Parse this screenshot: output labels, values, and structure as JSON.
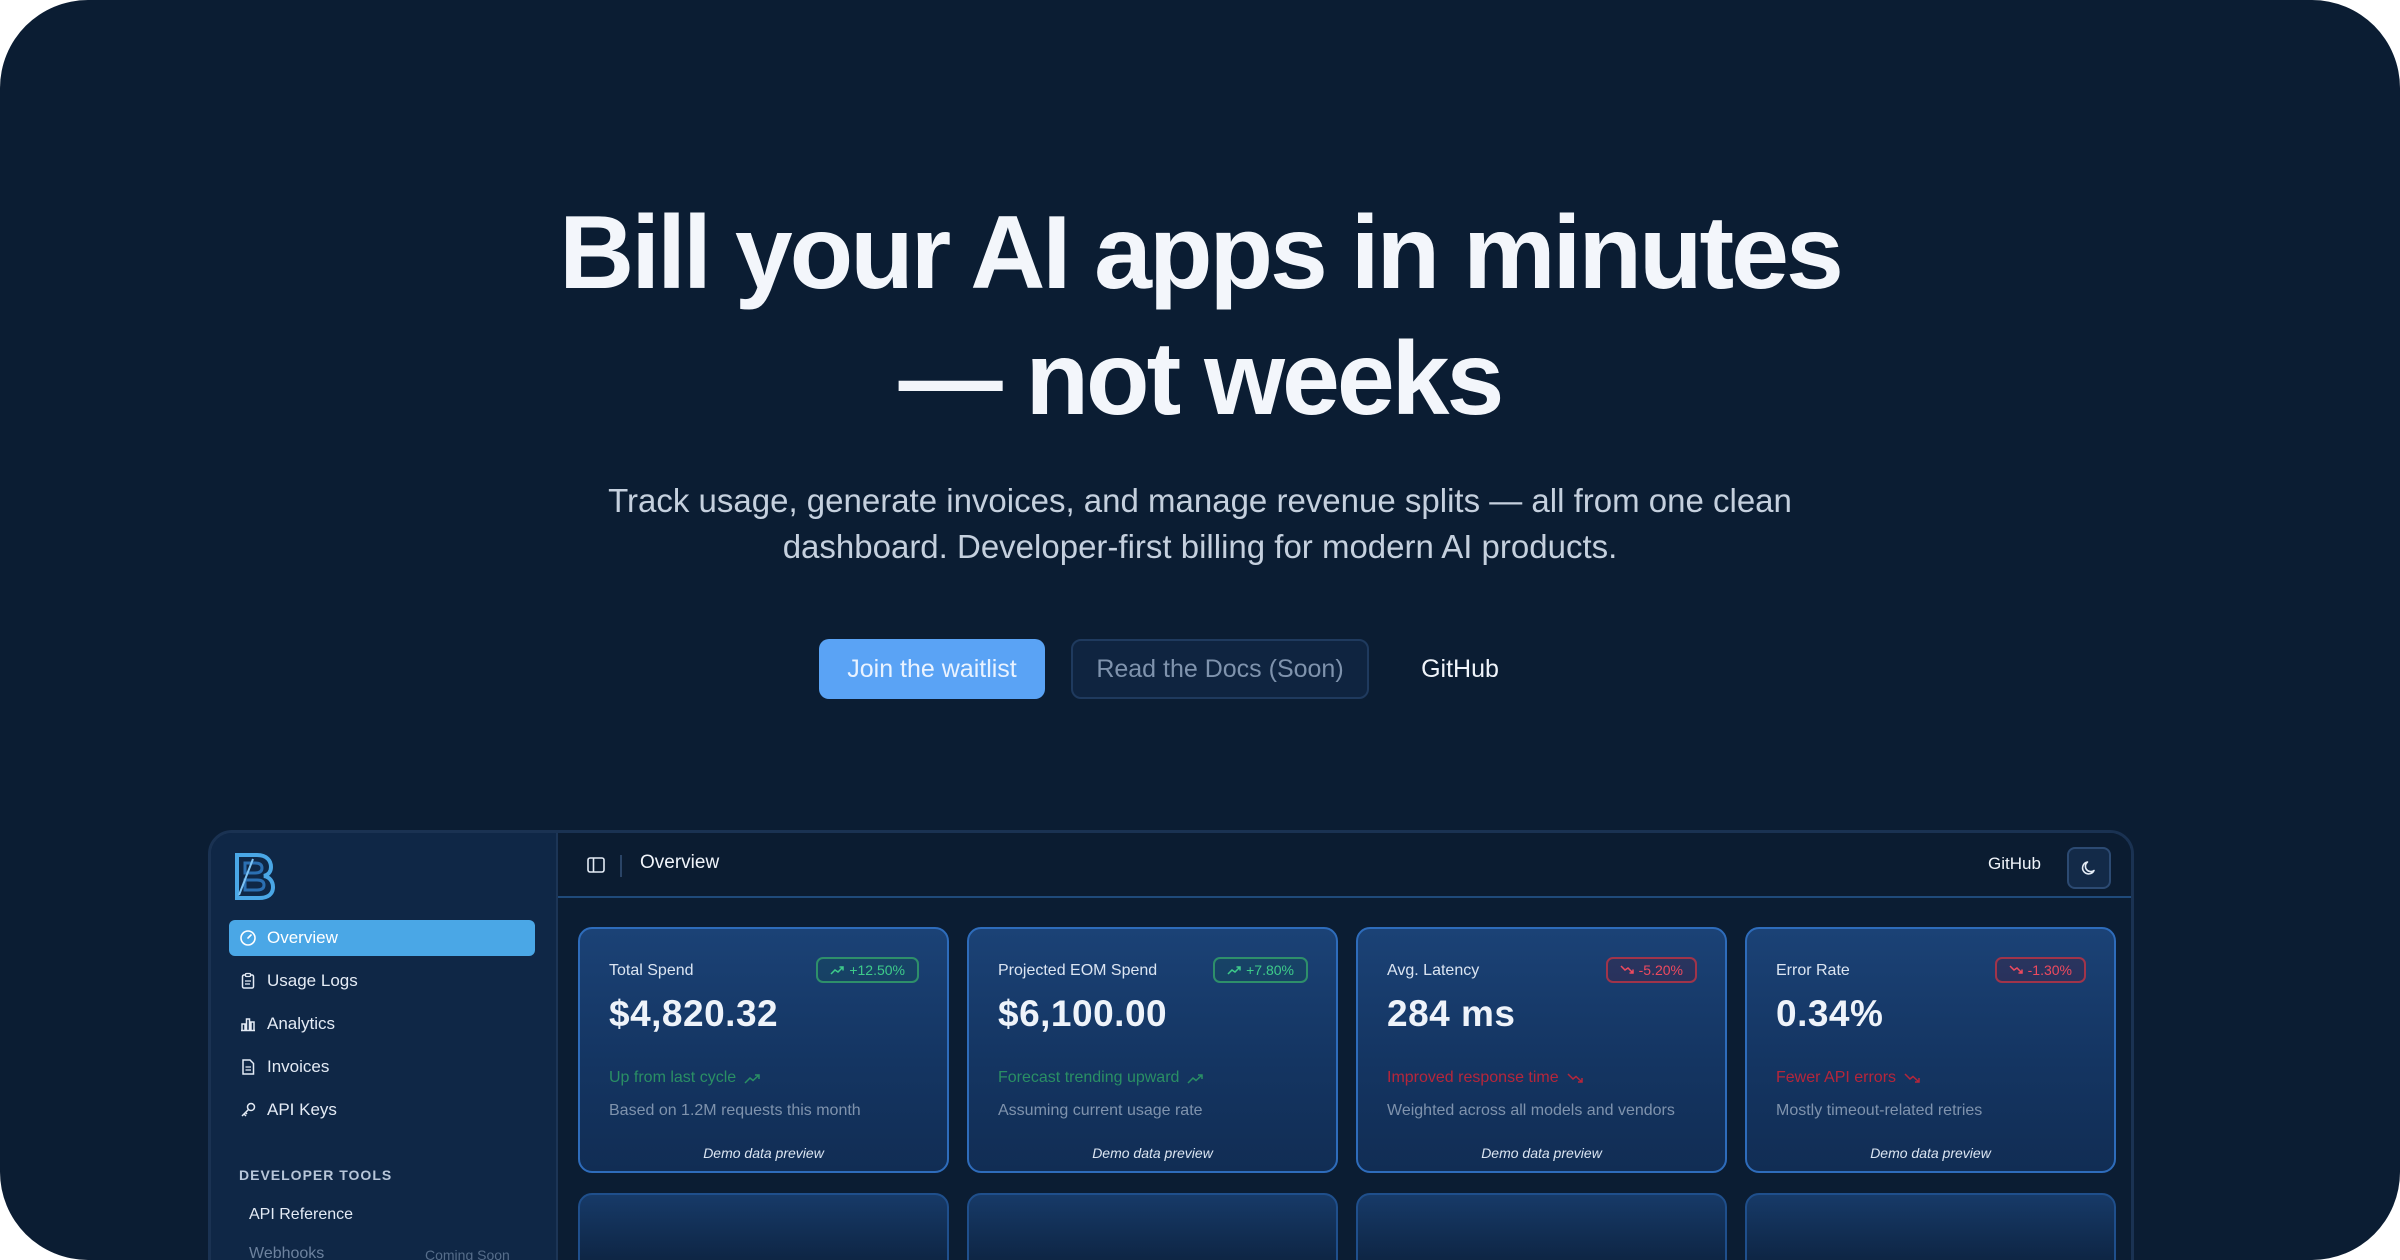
{
  "hero": {
    "title_line1": "Bill your AI apps in minutes",
    "title_line2": "— not weeks",
    "subtitle": "Track usage, generate invoices, and manage revenue splits — all from one clean dashboard. Developer-first billing for modern AI products.",
    "primary_cta": "Join the waitlist",
    "secondary_cta": "Read the Docs (Soon)",
    "link_cta": "GitHub"
  },
  "dashboard": {
    "logo_icon": "b-monogram-logo-icon",
    "sidebar": {
      "items": [
        {
          "label": "Overview",
          "icon": "dashboard-gauge-icon",
          "active": true
        },
        {
          "label": "Usage Logs",
          "icon": "clipboard-icon",
          "active": false
        },
        {
          "label": "Analytics",
          "icon": "bar-chart-icon",
          "active": false
        },
        {
          "label": "Invoices",
          "icon": "document-icon",
          "active": false
        },
        {
          "label": "API Keys",
          "icon": "key-icon",
          "active": false
        }
      ],
      "section_label": "DEVELOPER TOOLS",
      "tools": [
        {
          "label": "API Reference"
        },
        {
          "label": "Webhooks",
          "badge": "Coming Soon"
        }
      ]
    },
    "topbar": {
      "title": "Overview",
      "github": "GitHub",
      "toggle_icon": "sidebar-panel-icon",
      "theme_icon": "moon-icon"
    },
    "cards": [
      {
        "label": "Total Spend",
        "badge": "+12.50%",
        "direction": "up",
        "value": "$4,820.32",
        "trend": "Up from last cycle",
        "desc": "Based on 1.2M requests this month",
        "foot": "Demo data preview"
      },
      {
        "label": "Projected EOM Spend",
        "badge": "+7.80%",
        "direction": "up",
        "value": "$6,100.00",
        "trend": "Forecast trending upward",
        "desc": "Assuming current usage rate",
        "foot": "Demo data preview"
      },
      {
        "label": "Avg. Latency",
        "badge": "-5.20%",
        "direction": "down",
        "value": "284 ms",
        "trend": "Improved response time",
        "desc": "Weighted across all models and vendors",
        "foot": "Demo data preview"
      },
      {
        "label": "Error Rate",
        "badge": "-1.30%",
        "direction": "down",
        "value": "0.34%",
        "trend": "Fewer API errors",
        "desc": "Mostly timeout-related retries",
        "foot": "Demo data preview"
      }
    ],
    "colors": {
      "accent": "#4aa7e6",
      "primary_button": "#5aa3f5",
      "positive": "#3ecb8a",
      "negative": "#ef4a5e",
      "background": "#0b1d33"
    }
  }
}
